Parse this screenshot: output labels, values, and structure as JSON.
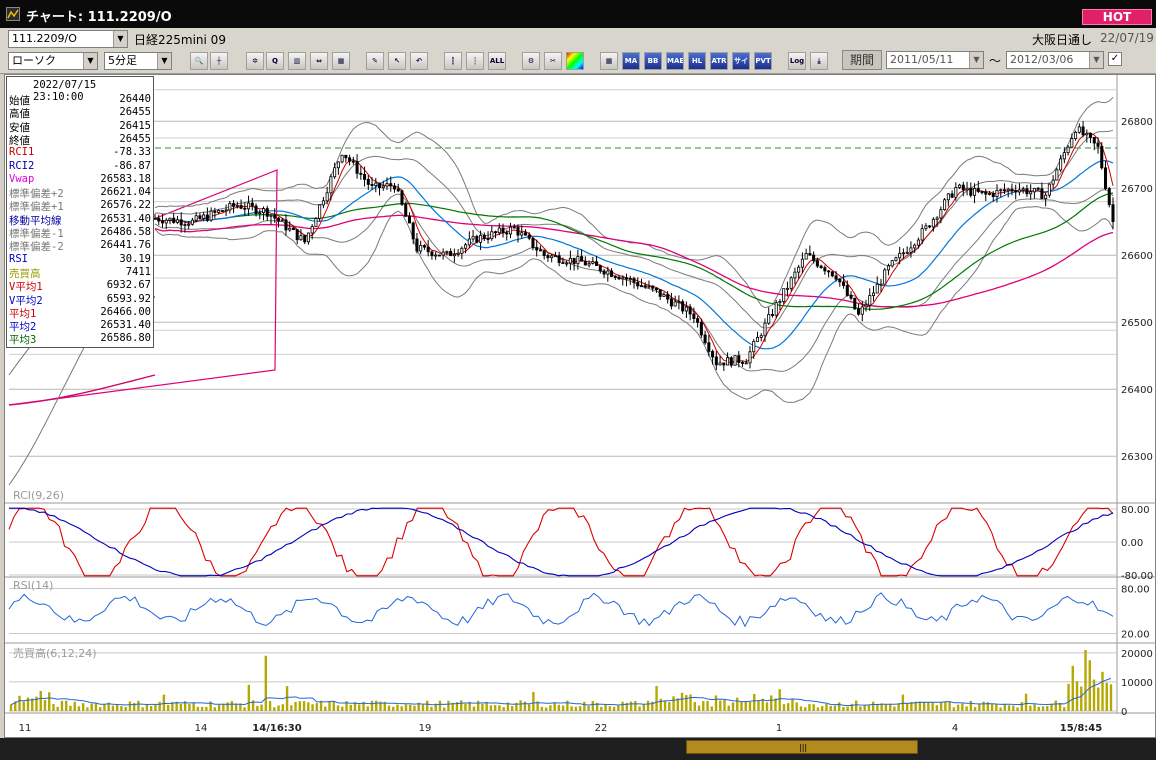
{
  "window": {
    "title": "チャート: 111.2209/O",
    "hot_label": "HOT"
  },
  "toolbar": {
    "symbol_value": "111.2209/O",
    "symbol_name": "日経225mini 09",
    "chart_type": "ローソク",
    "interval": "5分足",
    "market": "大阪日通し",
    "market_date": "22/07/19",
    "period_label": "期間",
    "from_date": "2011/05/11",
    "to_date": "2012/03/06",
    "tilde": "～",
    "indicator_buttons": [
      "MA",
      "BB",
      "MAE",
      "HL",
      "ATR",
      "サイコ",
      "PVT"
    ],
    "log_label": "Log"
  },
  "info": {
    "datetime": "2022/07/15  23:10:00",
    "rows": [
      {
        "label": "始値",
        "value": "26440",
        "color": "#000000"
      },
      {
        "label": "高値",
        "value": "26455",
        "color": "#000000"
      },
      {
        "label": "安値",
        "value": "26415",
        "color": "#000000"
      },
      {
        "label": "終値",
        "value": "26455",
        "color": "#000000"
      },
      {
        "label": "RCI1",
        "value": "-78.33",
        "color": "#cc0000"
      },
      {
        "label": "RCI2",
        "value": "-86.87",
        "color": "#0000aa"
      },
      {
        "label": "Vwap",
        "value": "26583.18",
        "color": "#dd00dd"
      },
      {
        "label": "標準偏差+2",
        "value": "26621.04",
        "color": "#777777"
      },
      {
        "label": "標準偏差+1",
        "value": "26576.22",
        "color": "#777777"
      },
      {
        "label": "移動平均線",
        "value": "26531.40",
        "color": "#0000aa"
      },
      {
        "label": "標準偏差-1",
        "value": "26486.58",
        "color": "#777777"
      },
      {
        "label": "標準偏差-2",
        "value": "26441.76",
        "color": "#777777"
      },
      {
        "label": "RSI",
        "value": "30.19",
        "color": "#0000cc"
      },
      {
        "label": "売買高",
        "value": "7411",
        "color": "#999900"
      },
      {
        "label": "V平均1",
        "value": "6932.67",
        "color": "#cc0000"
      },
      {
        "label": "V平均2",
        "value": "6593.92",
        "color": "#0000cc"
      },
      {
        "label": "平均1",
        "value": "26466.00",
        "color": "#cc0000"
      },
      {
        "label": "平均2",
        "value": "26531.40",
        "color": "#0000cc"
      },
      {
        "label": "平均3",
        "value": "26586.80",
        "color": "#006600"
      }
    ]
  },
  "panes": {
    "rci_label": "RCI(9,26)",
    "rsi_label": "RSI(14)",
    "vol_label": "売買高(6,12,24)"
  },
  "chart_data": {
    "type": "candlestick",
    "price_ticks": [
      "26800",
      "26700",
      "26600",
      "26500",
      "26400",
      "26300"
    ],
    "price_ylim": [
      26260,
      26860
    ],
    "rci_ticks": [
      "80.00",
      "0.00",
      "-80.00"
    ],
    "rsi_ticks": [
      "80.00",
      "20.00"
    ],
    "vol_ticks": [
      "20000",
      "10000",
      "0"
    ],
    "x_labels": [
      "11",
      "14",
      "14/16:30",
      "19",
      "22",
      "1",
      "4",
      "15/8:45"
    ],
    "dashed_level": 26760,
    "colors": {
      "candle_up": "#ffffff",
      "candle_down": "#000000",
      "ma_short": "#cc0000",
      "ma_mid": "#0077dd",
      "ma_long": "#007700",
      "vwap": "#e0007a",
      "bands": "#7a7a7a",
      "rci_fast": "#dd0000",
      "rci_slow": "#0000bb",
      "rsi": "#2266dd",
      "volume": "#b5a800"
    }
  }
}
